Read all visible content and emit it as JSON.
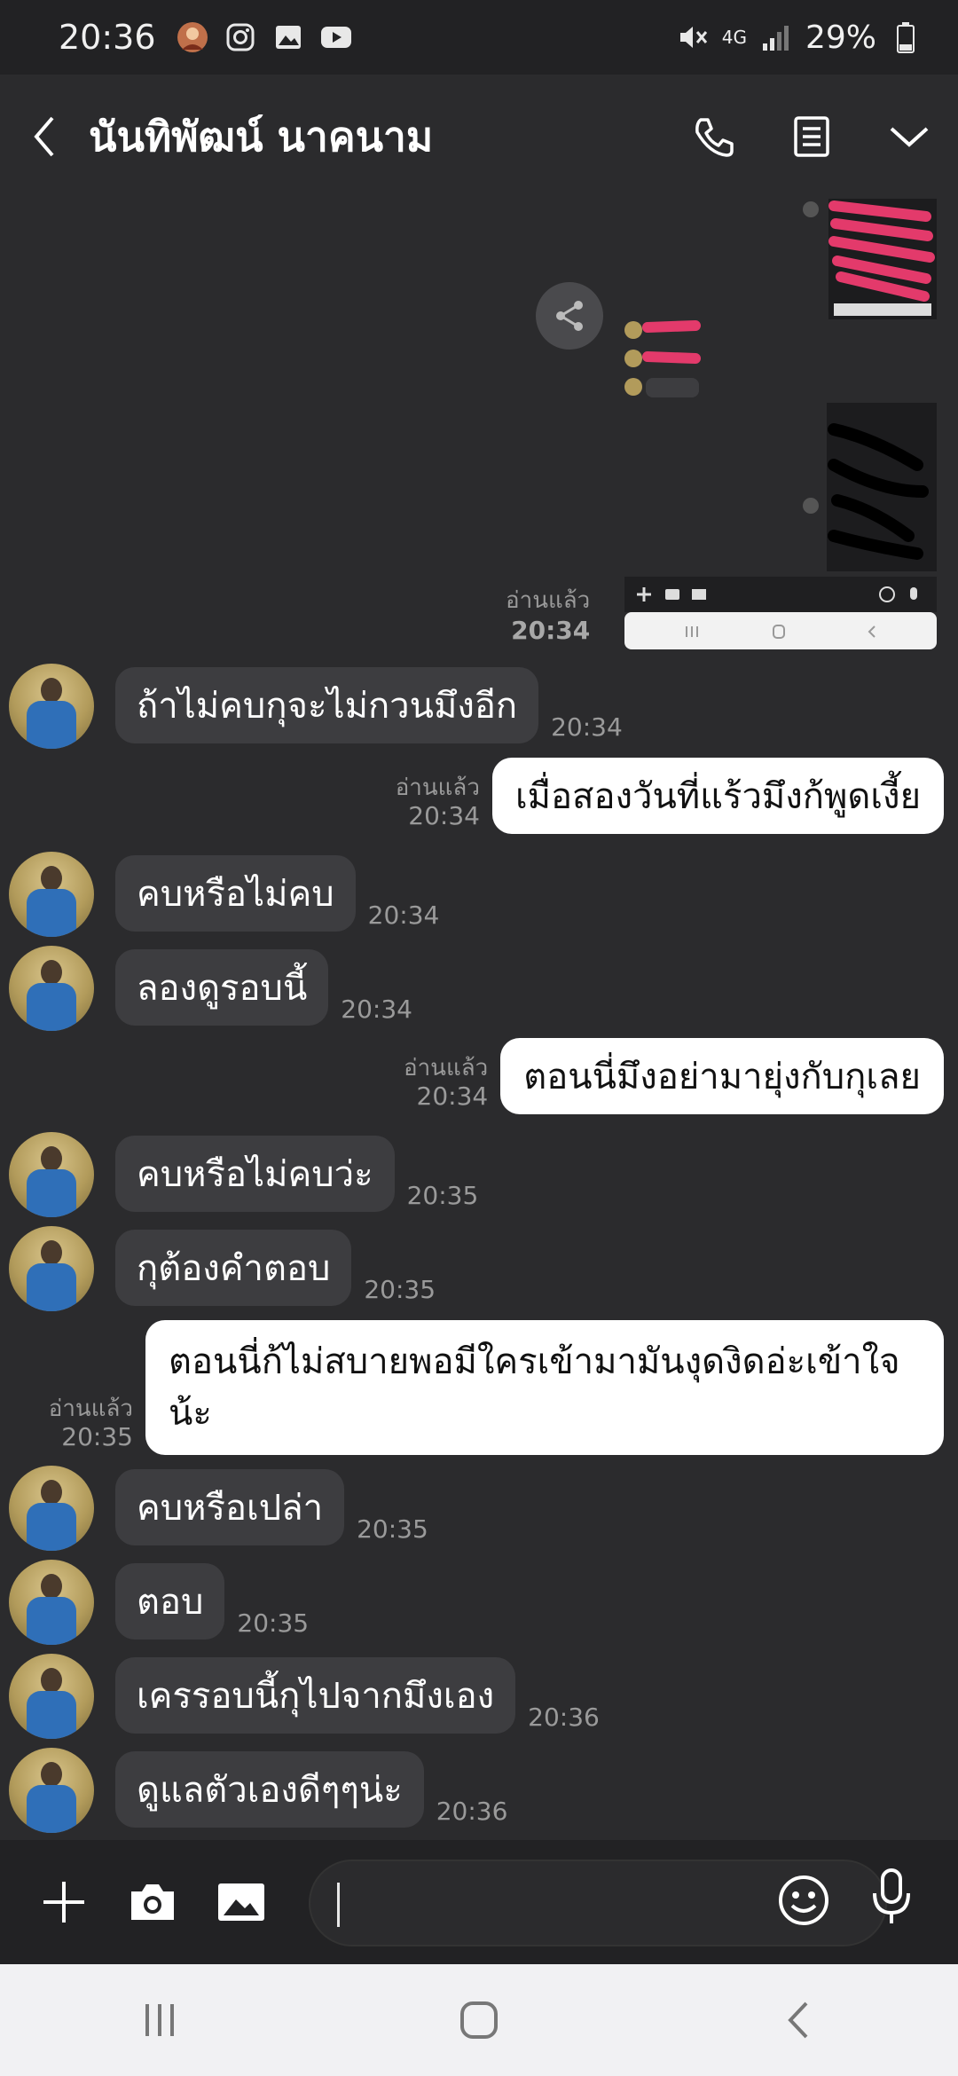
{
  "status_bar": {
    "time": "20:36",
    "network": "4G",
    "battery": "29%",
    "icons": [
      "game-avatar-icon",
      "instagram-icon",
      "gallery-icon",
      "youtube-icon",
      "mute-icon",
      "signal-icon",
      "battery-icon"
    ]
  },
  "header": {
    "title": "นันทิพัฒน์ นาคนาม",
    "icons": [
      "back-icon",
      "phone-icon",
      "notes-icon",
      "chevron-down-icon"
    ]
  },
  "image_message": {
    "read_label": "อ่านแล้ว",
    "time": "20:34"
  },
  "messages": [
    {
      "side": "in",
      "text": "ถ้าไม่คบกุจะไม่กวนมึงอีก",
      "time": "20:34"
    },
    {
      "side": "out",
      "text": "เมื่อสองวันที่แร้วมึงก้พูดเงี้ย",
      "time": "20:34",
      "read": "อ่านแล้ว"
    },
    {
      "side": "in",
      "text": "คบหรือไม่คบ",
      "time": "20:34"
    },
    {
      "side": "in",
      "text": "ลองดูรอบนี้",
      "time": "20:34"
    },
    {
      "side": "out",
      "text": "ตอนนี่มึงอย่ามายุ่งกับกุเลย",
      "time": "20:34",
      "read": "อ่านแล้ว"
    },
    {
      "side": "in",
      "text": "คบหรือไม่คบว่ะ",
      "time": "20:35"
    },
    {
      "side": "in",
      "text": "กุต้องคำตอบ",
      "time": "20:35"
    },
    {
      "side": "out",
      "text": "ตอนนี่ก้ไม่สบายพอมีใครเข้ามามันงุดงิดอ่ะเข้าใจน้ะ",
      "time": "20:35",
      "read": "อ่านแล้ว"
    },
    {
      "side": "in",
      "text": "คบหรือเปล่า",
      "time": "20:35"
    },
    {
      "side": "in",
      "text": "ตอบ",
      "time": "20:35"
    },
    {
      "side": "in",
      "text": "เครรอบนี้กุไปจากมึงเอง",
      "time": "20:36"
    },
    {
      "side": "in",
      "text": "ดูแลตัวเองดีๆๆน่ะ",
      "time": "20:36"
    }
  ],
  "input_bar": {
    "icons": [
      "plus-icon",
      "camera-icon",
      "image-icon",
      "emoji-icon",
      "mic-icon"
    ],
    "value": ""
  },
  "system_nav": {
    "icons": [
      "recents-icon",
      "home-icon",
      "back-nav-icon"
    ]
  },
  "colors": {
    "background": "#2b2b2d",
    "bubble_in": "#3d3d40",
    "bubble_out": "#ffffff",
    "meta_text": "#9a9a9a"
  }
}
